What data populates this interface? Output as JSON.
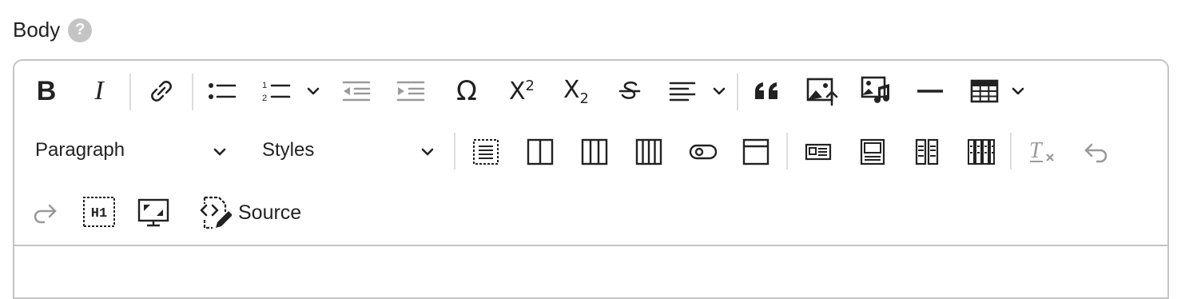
{
  "field": {
    "label": "Body",
    "help_glyph": "?"
  },
  "toolbar": {
    "bold_label": "B",
    "italic_label": "I",
    "omega_label": "Ω",
    "superscript_label": "X",
    "superscript_sub": "2",
    "subscript_label": "X",
    "subscript_sub": "2",
    "heading_dropdown": "Paragraph",
    "styles_dropdown": "Styles",
    "h1_label": "H1",
    "source_label": "Source"
  },
  "colors": {
    "icon": "#222222",
    "disabled_icon": "#9a9a9a",
    "border": "#c4c4c4"
  }
}
